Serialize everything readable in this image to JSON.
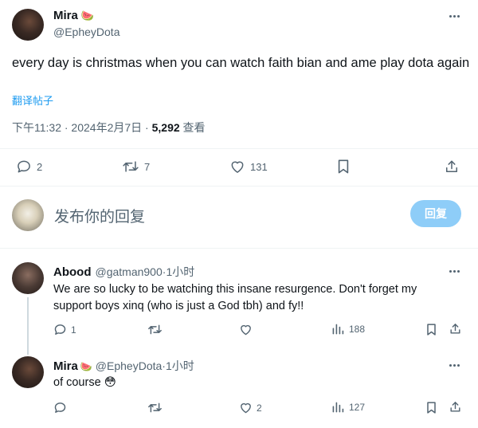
{
  "main_tweet": {
    "author_name": "Mira",
    "author_emoji": "🍉",
    "handle": "@EpheyDota",
    "text": "every day is christmas when you can watch faith bian and ame play dota again",
    "translate_link": "翻译帖子",
    "time": "下午11:32 · 2024年2月7日 · ",
    "views_count": "5,292",
    "views_label": " 查看",
    "actions": {
      "reply_count": "2",
      "retweet_count": "7",
      "like_count": "131"
    }
  },
  "composer": {
    "placeholder": "发布你的回复",
    "reply_button": "回复"
  },
  "replies": [
    {
      "author_name": "Abood",
      "handle": "@gatman900",
      "dot": " · ",
      "time": "1小时",
      "text_line1": "We are so lucky to be watching this insane resurgence. Don't forget my",
      "text_line2": "support boys xinq (who is just a God tbh) and fy!!",
      "reply_count": "1",
      "retweet_count": "",
      "like_count": "",
      "view_count": "188"
    },
    {
      "author_name": "Mira",
      "author_emoji": "🍉",
      "handle": "@EpheyDota",
      "dot": " · ",
      "time": "1小时",
      "text": "of course",
      "text_emoji": "😳",
      "reply_count": "",
      "retweet_count": "",
      "like_count": "2",
      "view_count": "127"
    }
  ],
  "colors": {
    "text": "#0f1419",
    "muted": "#536471",
    "accent": "#1d9bf0",
    "reply_button_disabled": "#8ecdf8",
    "divider": "#eff3f4"
  }
}
